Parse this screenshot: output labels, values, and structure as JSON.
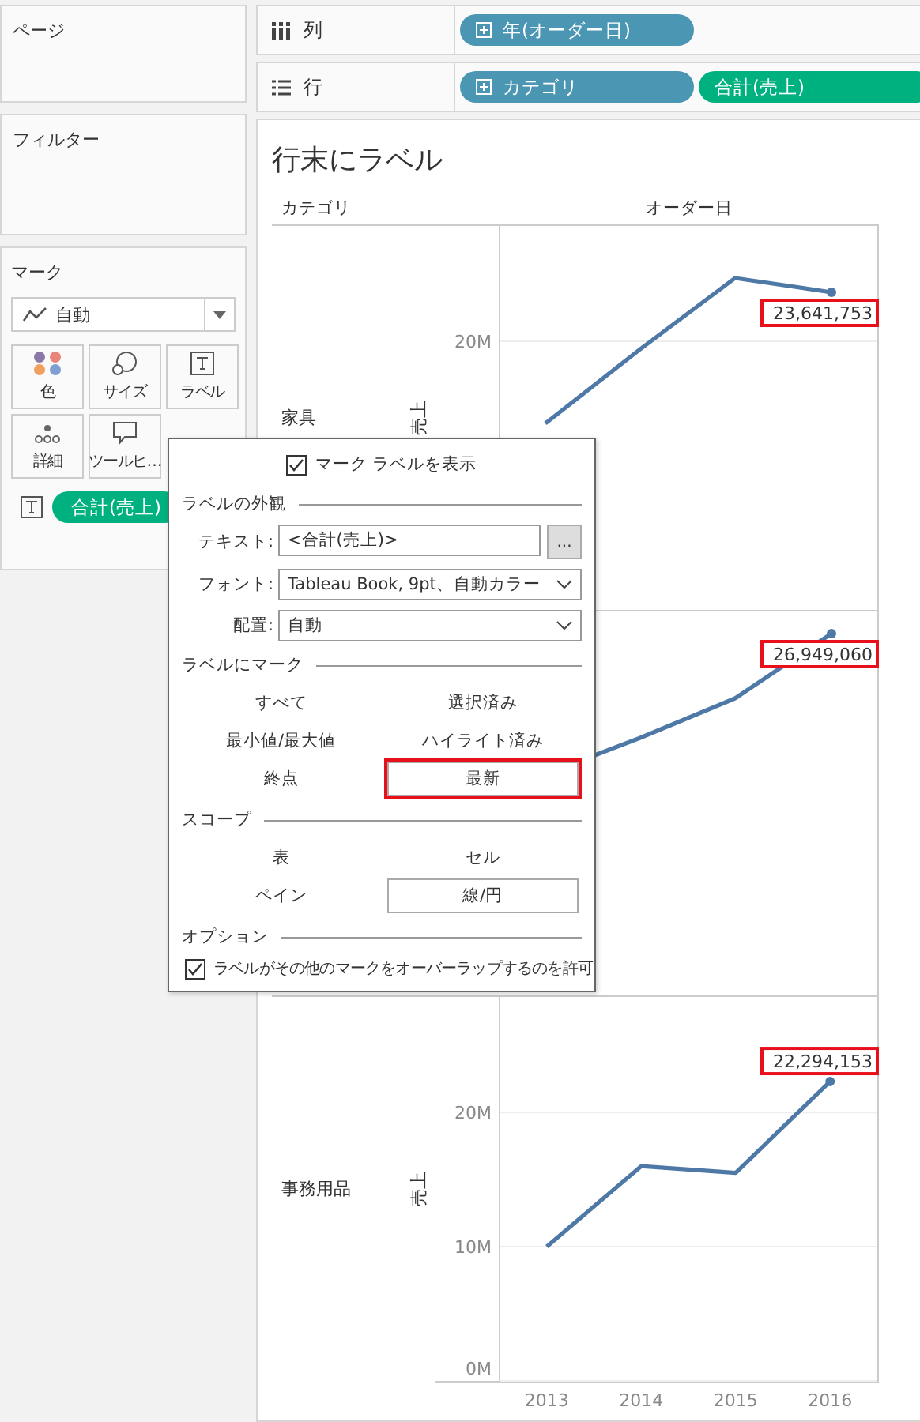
{
  "left_panel": {
    "pages_title": "ページ",
    "filters_title": "フィルター",
    "marks": {
      "title": "マーク",
      "mark_type": "自動",
      "buttons": [
        {
          "label": "色",
          "kind": "color"
        },
        {
          "label": "サイズ",
          "kind": "size"
        },
        {
          "label": "ラベル",
          "kind": "label"
        },
        {
          "label": "詳細",
          "kind": "detail"
        },
        {
          "label": "ツールヒ…",
          "kind": "tooltip"
        }
      ],
      "fields": [
        {
          "kind": "label",
          "pill": "合計(売上)"
        }
      ]
    }
  },
  "shelves": [
    {
      "label": "列",
      "kind": "columns",
      "pills": [
        {
          "text": "年(オーダー日)",
          "kind": "dimension"
        }
      ]
    },
    {
      "label": "行",
      "kind": "rows",
      "pills": [
        {
          "text": "カテゴリ",
          "kind": "dimension"
        },
        {
          "text": "合計(売上)",
          "kind": "measure"
        }
      ]
    }
  ],
  "view": {
    "title": "行末にラベル",
    "row_header": "カテゴリ",
    "column_header": "オーダー日",
    "panes": [
      {
        "category": "家具",
        "axis_title": "売上",
        "tick_labels": [
          "20M"
        ],
        "value_label": "23,641,753",
        "highlighted": true
      },
      {
        "value_label": "26,949,060",
        "highlighted": true
      },
      {
        "category": "事務用品",
        "axis_title": "売上",
        "value_label": "22,294,153",
        "highlighted": true,
        "chart_data": {
          "type": "line",
          "categories": [
            "2013",
            "2014",
            "2015",
            "2016"
          ],
          "values": [
            10000000,
            16000000,
            15500000,
            22300000
          ],
          "ylim": [
            0,
            28600000
          ],
          "yticks": [
            {
              "value": 0,
              "label": "0M"
            },
            {
              "value": 10000000,
              "label": "10M"
            },
            {
              "value": 20000000,
              "label": "20M"
            }
          ]
        }
      }
    ]
  },
  "popup": {
    "show_labels": {
      "label": "マーク ラベルを表示",
      "checked": true
    },
    "appearance": {
      "title": "ラベルの外観",
      "text": {
        "label": "テキスト:",
        "value": "<合計(売上)>",
        "button": "..."
      },
      "font": {
        "label": "フォント:",
        "value": "Tableau Book, 9pt、自動カラー"
      },
      "alignment": {
        "label": "配置:",
        "value": "自動"
      }
    },
    "marks_to_label": {
      "title": "ラベルにマーク",
      "options": [
        {
          "label": "すべて",
          "selected": false,
          "highlighted": false
        },
        {
          "label": "選択済み",
          "selected": false,
          "highlighted": false
        },
        {
          "label": "最小値/最大値",
          "selected": false,
          "highlighted": false
        },
        {
          "label": "ハイライト済み",
          "selected": false,
          "highlighted": false
        },
        {
          "label": "終点",
          "selected": false,
          "highlighted": false
        },
        {
          "label": "最新",
          "selected": true,
          "highlighted": true
        }
      ]
    },
    "scope": {
      "title": "スコープ",
      "options": [
        {
          "label": "表",
          "selected": false,
          "highlighted": false
        },
        {
          "label": "セル",
          "selected": false,
          "highlighted": false
        },
        {
          "label": "ペイン",
          "selected": false,
          "highlighted": false
        },
        {
          "label": "線/円",
          "selected": true,
          "highlighted": false
        }
      ]
    },
    "options": {
      "title": "オプション",
      "allow_overlap": {
        "label": "ラベルがその他のマークをオーバーラップするのを許可",
        "checked": true
      }
    }
  }
}
